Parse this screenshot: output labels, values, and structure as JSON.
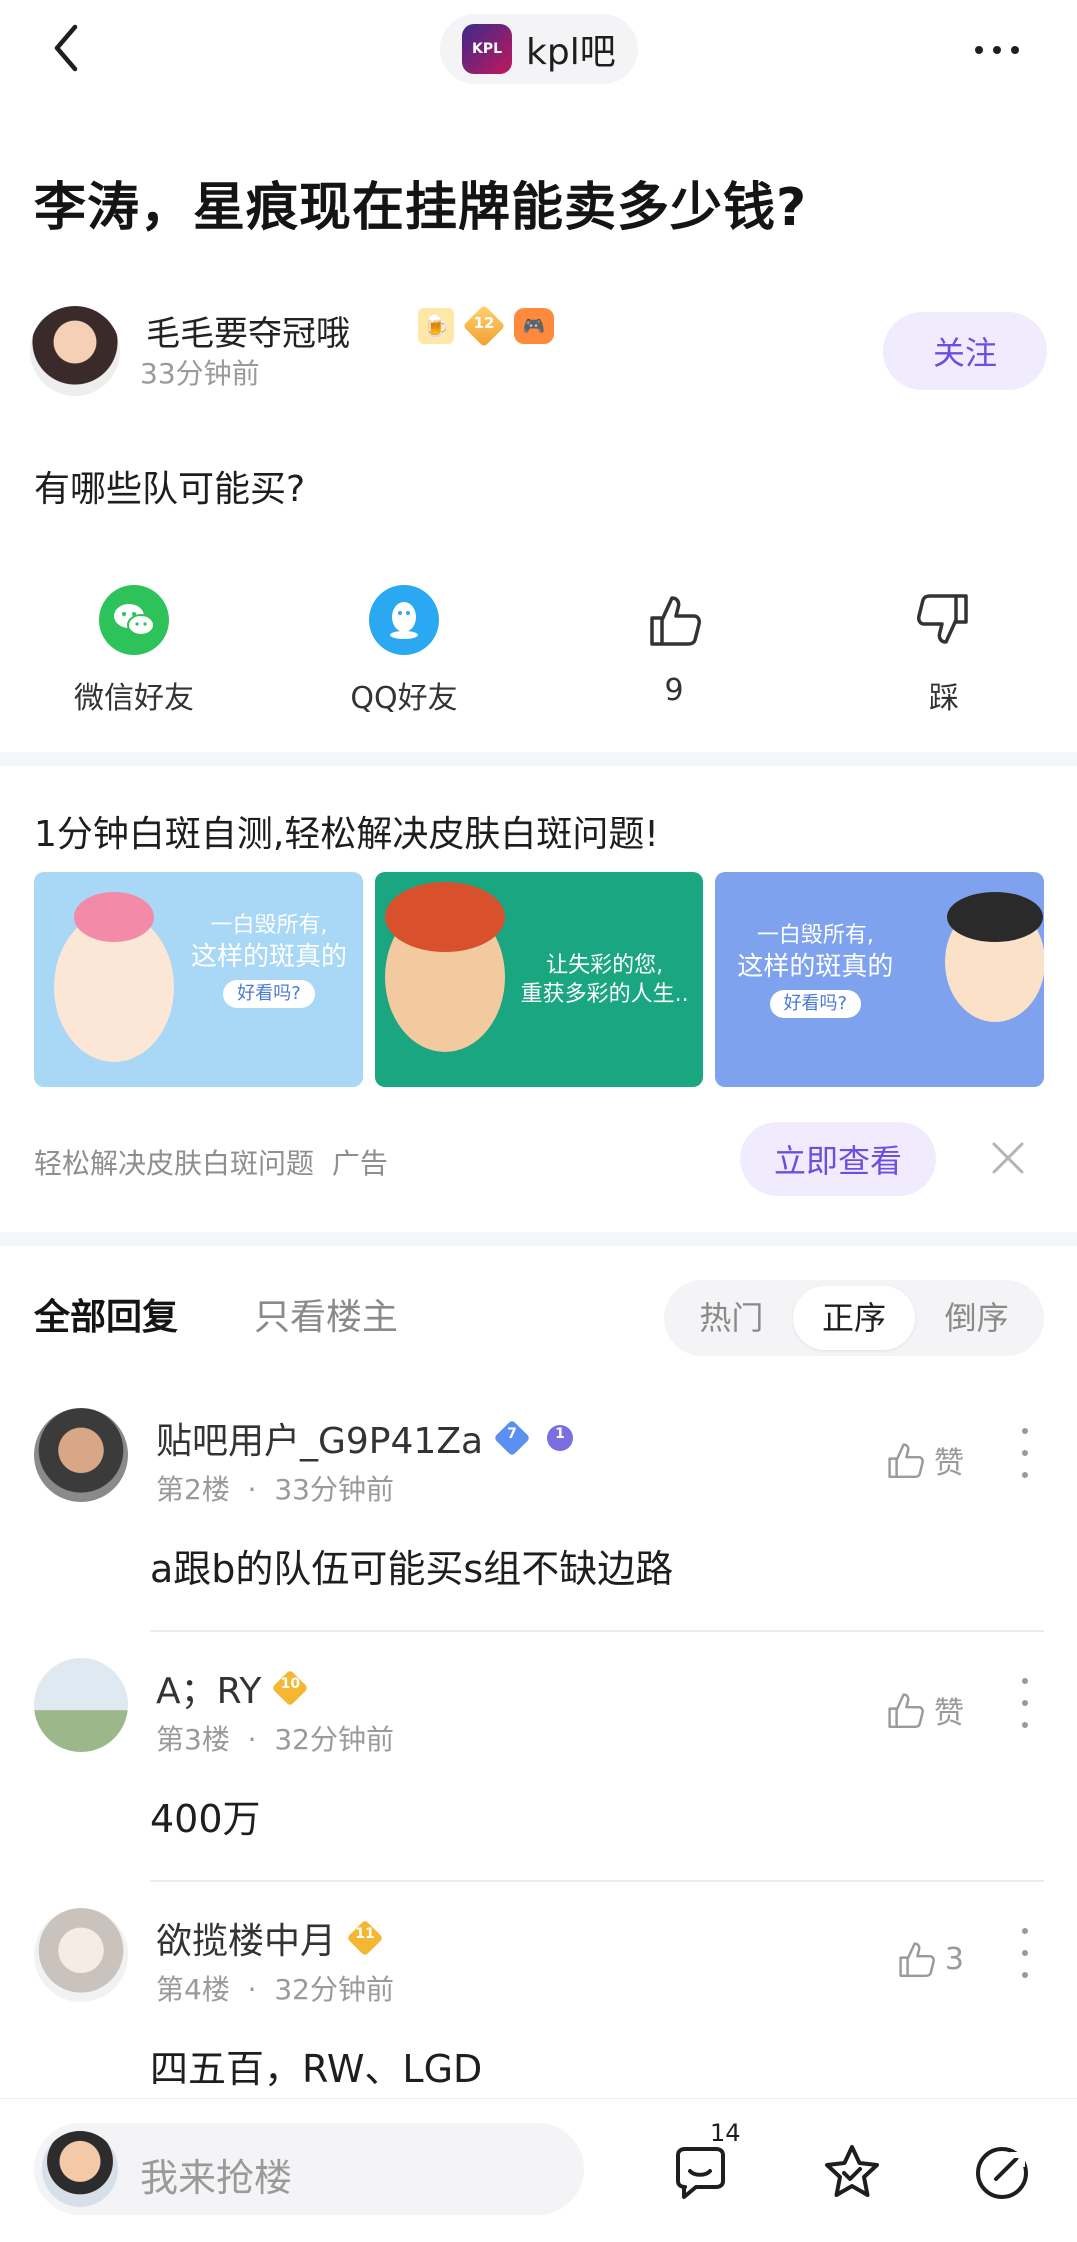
{
  "header": {
    "forum_name": "kpl吧",
    "forum_logo_text": "KPL"
  },
  "post": {
    "title": "李涛，星痕现在挂牌能卖多少钱?",
    "author": {
      "name": "毛毛要夺冠哦",
      "level": "12",
      "time": "33分钟前"
    },
    "follow_label": "关注",
    "body": "有哪些队可能买?"
  },
  "share": {
    "wechat_label": "微信好友",
    "qq_label": "QQ好友",
    "like_count": "9",
    "dislike_label": "踩"
  },
  "ad": {
    "title": "1分钟白斑自测,轻松解决皮肤白斑问题!",
    "images": [
      {
        "line1": "一白毁所有,",
        "line2": "这样的斑真的",
        "pill": "好看吗?"
      },
      {
        "line1": "让失彩的您,",
        "line2": "重获多彩的人生.."
      },
      {
        "line1": "一白毁所有,",
        "line2": "这样的斑真的",
        "pill": "好看吗?"
      }
    ],
    "source": "轻松解决皮肤白斑问题",
    "ad_tag": "广告",
    "cta": "立即查看"
  },
  "tabs": {
    "all": "全部回复",
    "op_only": "只看楼主",
    "sort": [
      "热门",
      "正序",
      "倒序"
    ],
    "sort_active": "正序"
  },
  "replies": [
    {
      "user": "贴吧用户_G9P41Za",
      "level": "7",
      "badge_num": "1",
      "floor": "第2楼",
      "time": "33分钟前",
      "like": "赞",
      "text": "a跟b的队伍可能买s组不缺边路"
    },
    {
      "user": "A；RY",
      "level": "10",
      "floor": "第3楼",
      "time": "32分钟前",
      "like": "赞",
      "text": "400万"
    },
    {
      "user": "欲揽楼中月",
      "level": "11",
      "floor": "第4楼",
      "time": "32分钟前",
      "like": "3",
      "text": "四五百，RW、LGD"
    }
  ],
  "bottom": {
    "placeholder": "我来抢楼",
    "comment_count": "14"
  },
  "colors": {
    "accent": "#6a4fe0",
    "accent_bg": "#f1ecfd",
    "wechat": "#2dc25a",
    "qq": "#2aa8f2",
    "level_gold": "#f5b731",
    "level_blue": "#5b8ff0"
  }
}
